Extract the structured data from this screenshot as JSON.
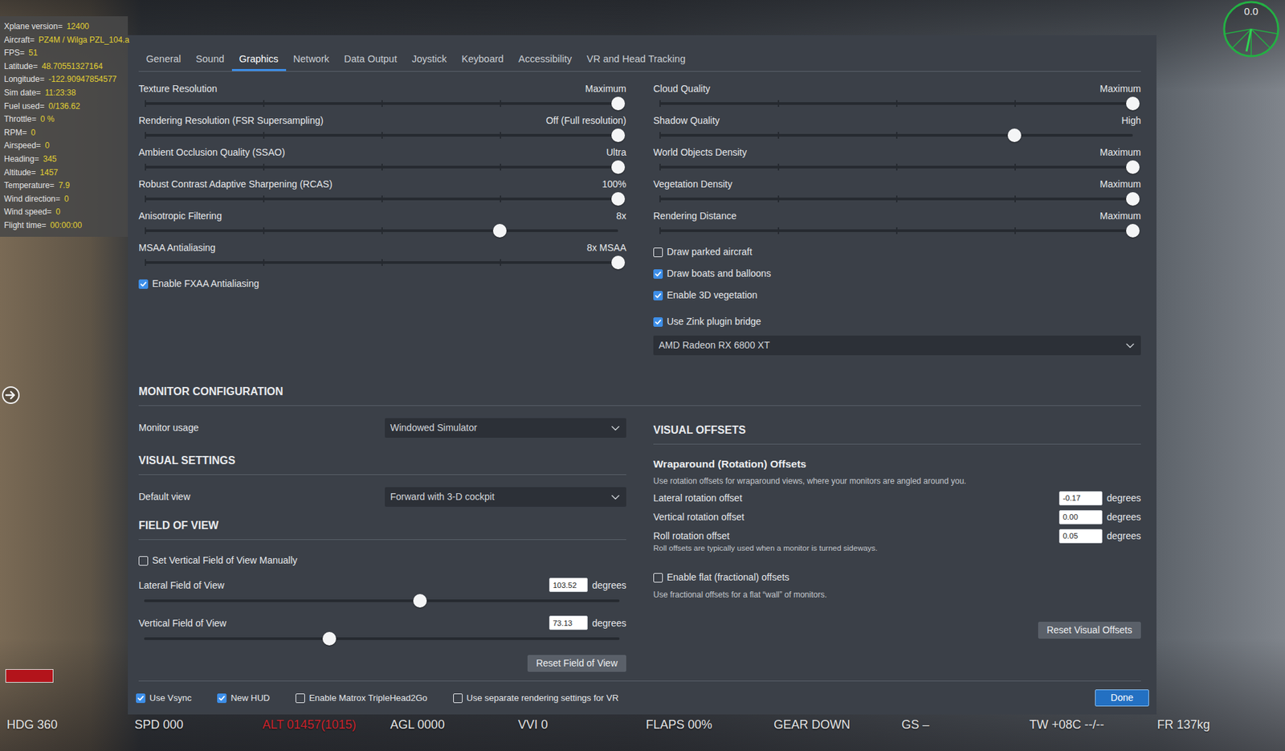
{
  "overlay": {
    "lines": [
      {
        "label": "Xplane version=",
        "value": "12400"
      },
      {
        "label": "Aircraft=",
        "value": "PZ4M / Wilga PZL_104.a"
      },
      {
        "label": "FPS=",
        "value": "51"
      },
      {
        "label": "Latitude=",
        "value": "48.70551327164"
      },
      {
        "label": "Longitude=",
        "value": "-122.90947854577"
      },
      {
        "label": "Sim date=",
        "value": "11:23:38"
      },
      {
        "label": "Fuel used=",
        "value": "0/136.62"
      },
      {
        "label": "Throttle=",
        "value": "0 %"
      },
      {
        "label": "RPM=",
        "value": "0"
      },
      {
        "label": "Airspeed=",
        "value": "0"
      },
      {
        "label": "Heading=",
        "value": "345"
      },
      {
        "label": "Altitude=",
        "value": "1457"
      },
      {
        "label": "Temperature=",
        "value": "7.9"
      },
      {
        "label": "Wind direction=",
        "value": "0"
      },
      {
        "label": "Wind speed=",
        "value": "0"
      },
      {
        "label": "Flight time=",
        "value": "00:00:00"
      }
    ]
  },
  "compass": {
    "reading": "0.0"
  },
  "hud": [
    {
      "text": "HDG 360",
      "color": "#e4e4e4"
    },
    {
      "text": "SPD 000",
      "color": "#e4e4e4"
    },
    {
      "text": "ALT 01457(1015)",
      "color": "#c9232c"
    },
    {
      "text": "AGL 0000",
      "color": "#e4e4e4"
    },
    {
      "text": "VVI 0",
      "color": "#e4e4e4"
    },
    {
      "text": "FLAPS 00%",
      "color": "#e4e4e4"
    },
    {
      "text": "GEAR DOWN",
      "color": "#e4e4e4"
    },
    {
      "text": "GS –",
      "color": "#e4e4e4"
    },
    {
      "text": "TW +08C --/--",
      "color": "#e4e4e4"
    },
    {
      "text": "FR 137kg",
      "color": "#e4e4e4"
    }
  ],
  "dialog": {
    "tabs": [
      {
        "label": "General",
        "selected": false
      },
      {
        "label": "Sound",
        "selected": false
      },
      {
        "label": "Graphics",
        "selected": true
      },
      {
        "label": "Network",
        "selected": false
      },
      {
        "label": "Data Output",
        "selected": false
      },
      {
        "label": "Joystick",
        "selected": false
      },
      {
        "label": "Keyboard",
        "selected": false
      },
      {
        "label": "Accessibility",
        "selected": false
      },
      {
        "label": "VR and Head Tracking",
        "selected": false
      }
    ],
    "graphics": {
      "left": [
        {
          "kind": "slider",
          "label": "Texture Resolution",
          "reading": "Maximum",
          "level": 1
        },
        {
          "kind": "slider",
          "label": "Rendering Resolution (FSR Supersampling)",
          "reading": "Off (Full resolution)",
          "level": 1
        },
        {
          "kind": "slider",
          "label": "Ambient Occlusion Quality (SSAO)",
          "reading": "Ultra",
          "level": 1
        },
        {
          "kind": "slider",
          "label": "Robust Contrast Adaptive Sharpening (RCAS)",
          "reading": "100%",
          "level": 1
        },
        {
          "kind": "slider",
          "label": "Anisotropic Filtering",
          "reading": "8x",
          "level": 0.75
        },
        {
          "kind": "slider",
          "label": "MSAA Antialiasing",
          "reading": "8x MSAA",
          "level": 1
        },
        {
          "kind": "checkbox",
          "label": "Enable FXAA Antialiasing",
          "checked": true
        }
      ],
      "right": [
        {
          "kind": "slider",
          "label": "Cloud Quality",
          "reading": "Maximum",
          "level": 1
        },
        {
          "kind": "slider",
          "label": "Shadow Quality",
          "reading": "High",
          "level": 0.75
        },
        {
          "kind": "slider",
          "label": "World Objects Density",
          "reading": "Maximum",
          "level": 1
        },
        {
          "kind": "slider",
          "label": "Vegetation Density",
          "reading": "Maximum",
          "level": 1
        },
        {
          "kind": "slider",
          "label": "Rendering Distance",
          "reading": "Maximum",
          "level": 1
        },
        {
          "kind": "checkbox",
          "label": "Draw parked aircraft",
          "checked": false
        },
        {
          "kind": "checkbox",
          "label": "Draw boats and balloons",
          "checked": true
        },
        {
          "kind": "checkbox",
          "label": "Enable 3D vegetation",
          "checked": true
        },
        {
          "kind": "checkbox",
          "label": "Use Zink plugin bridge",
          "checked": true
        },
        {
          "kind": "select",
          "value": "AMD Radeon RX 6800 XT"
        }
      ]
    },
    "monitor_configuration": {
      "heading": "MONITOR CONFIGURATION",
      "usage": {
        "label": "Monitor usage",
        "value": "Windowed Simulator"
      }
    },
    "visual_settings": {
      "heading": "VISUAL SETTINGS",
      "default_view": {
        "label": "Default view",
        "value": "Forward with 3-D cockpit"
      }
    },
    "field_of_view": {
      "heading": "FIELD OF VIEW",
      "manual": {
        "label": "Set Vertical Field of View Manually",
        "checked": false
      },
      "sliders": [
        {
          "label": "Lateral Field of View",
          "value": "103.52",
          "unit": "degrees",
          "level": 0.58
        },
        {
          "label": "Vertical Field of View",
          "value": "73.13",
          "unit": "degrees",
          "level": 0.39
        }
      ],
      "reset": "Reset Field of View"
    },
    "visual_offsets": {
      "heading": "VISUAL OFFSETS",
      "subheading": "Wraparound (Rotation) Offsets",
      "note": "Use rotation offsets for wraparound views, where your monitors are angled around you.",
      "offsets": [
        {
          "label": "Lateral rotation offset",
          "value": "-0.17",
          "unit": "degrees"
        },
        {
          "label": "Vertical rotation offset",
          "value": "0.00",
          "unit": "degrees"
        },
        {
          "label": "Roll rotation offset",
          "value": "0.05",
          "unit": "degrees",
          "hint": "Roll offsets are typically used when a monitor is turned sideways."
        }
      ],
      "flat": {
        "label": "Enable flat (fractional) offsets",
        "checked": false,
        "note": "Use fractional offsets for a flat “wall” of monitors."
      },
      "reset": "Reset Visual Offsets"
    },
    "footer": {
      "checkboxes": [
        {
          "label": "Use Vsync",
          "checked": true
        },
        {
          "label": "New HUD",
          "checked": true
        },
        {
          "label": "Enable Matrox TripleHead2Go",
          "checked": false
        },
        {
          "label": "Use separate rendering settings for VR",
          "checked": false
        }
      ],
      "done": "Done"
    }
  }
}
